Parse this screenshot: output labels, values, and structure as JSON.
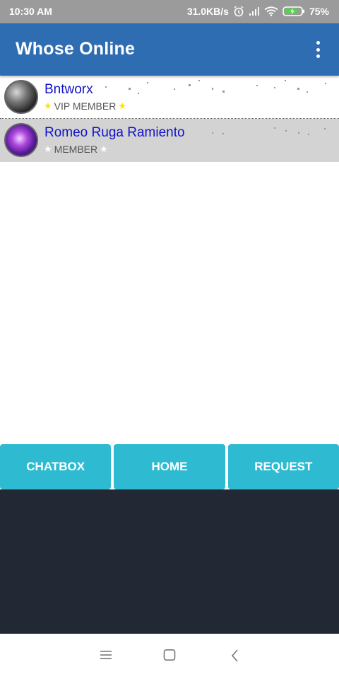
{
  "status_bar": {
    "time": "10:30 AM",
    "speed": "31.0KB/s",
    "battery": "75%",
    "icons": [
      "alarm-icon",
      "signal-icon",
      "wifi-icon",
      "battery-charging-icon"
    ]
  },
  "app_bar": {
    "title": "Whose Online",
    "menu_icon": "more-vert-icon"
  },
  "users": [
    {
      "name": "Bntworx",
      "role": "VIP MEMBER",
      "star_color": "#ffe100",
      "avatar_icon": "avatar-image",
      "selected": false
    },
    {
      "name": "Romeo Ruga Ramiento",
      "role": "MEMBER",
      "star_color": "#ffffff",
      "avatar_icon": "avatar-image",
      "selected": true
    }
  ],
  "buttons": {
    "chatbox": "CHATBOX",
    "home": "HOME",
    "request": "REQUEST"
  },
  "colors": {
    "app_bar": "#2f6db3",
    "button": "#2ebbd2",
    "footer": "#222834",
    "name_text": "#1212c8"
  },
  "nav_bar": {
    "icons": [
      "menu-icon",
      "home-square-icon",
      "back-icon"
    ]
  }
}
